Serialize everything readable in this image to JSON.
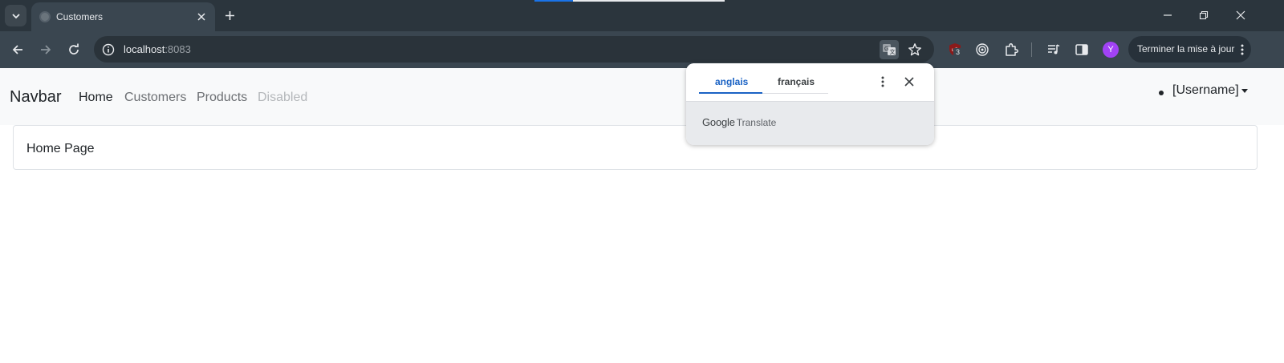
{
  "browser": {
    "tab_title": "Customers",
    "url_host": "localhost",
    "url_port": ":8083",
    "profile_initial": "Y",
    "ublock_count": "3",
    "update_label": "Terminer la mise à jour"
  },
  "navbar": {
    "brand": "Navbar",
    "links": [
      "Home",
      "Customers",
      "Products",
      "Disabled"
    ],
    "user": "[Username]"
  },
  "main": {
    "card_title": "Home Page"
  },
  "translate": {
    "source_lang": "anglais",
    "target_lang": "français",
    "google": "Google",
    "translate": "Translate"
  },
  "colors": {
    "chrome_dark": "#2b353d",
    "toolbar": "#3a4650",
    "accent_blue": "#1a62c4",
    "navbar_bg": "#f8f9fa",
    "avatar": "#a142f4"
  },
  "icons": [
    "tab-search-icon",
    "favicon-icon",
    "close-icon",
    "plus-icon",
    "minimize-icon",
    "restore-icon",
    "back-icon",
    "forward-icon",
    "reload-icon",
    "info-icon",
    "translate-icon",
    "star-icon",
    "ublock-icon",
    "target-icon",
    "extensions-icon",
    "media-icon",
    "side-panel-icon",
    "kebab-icon"
  ]
}
